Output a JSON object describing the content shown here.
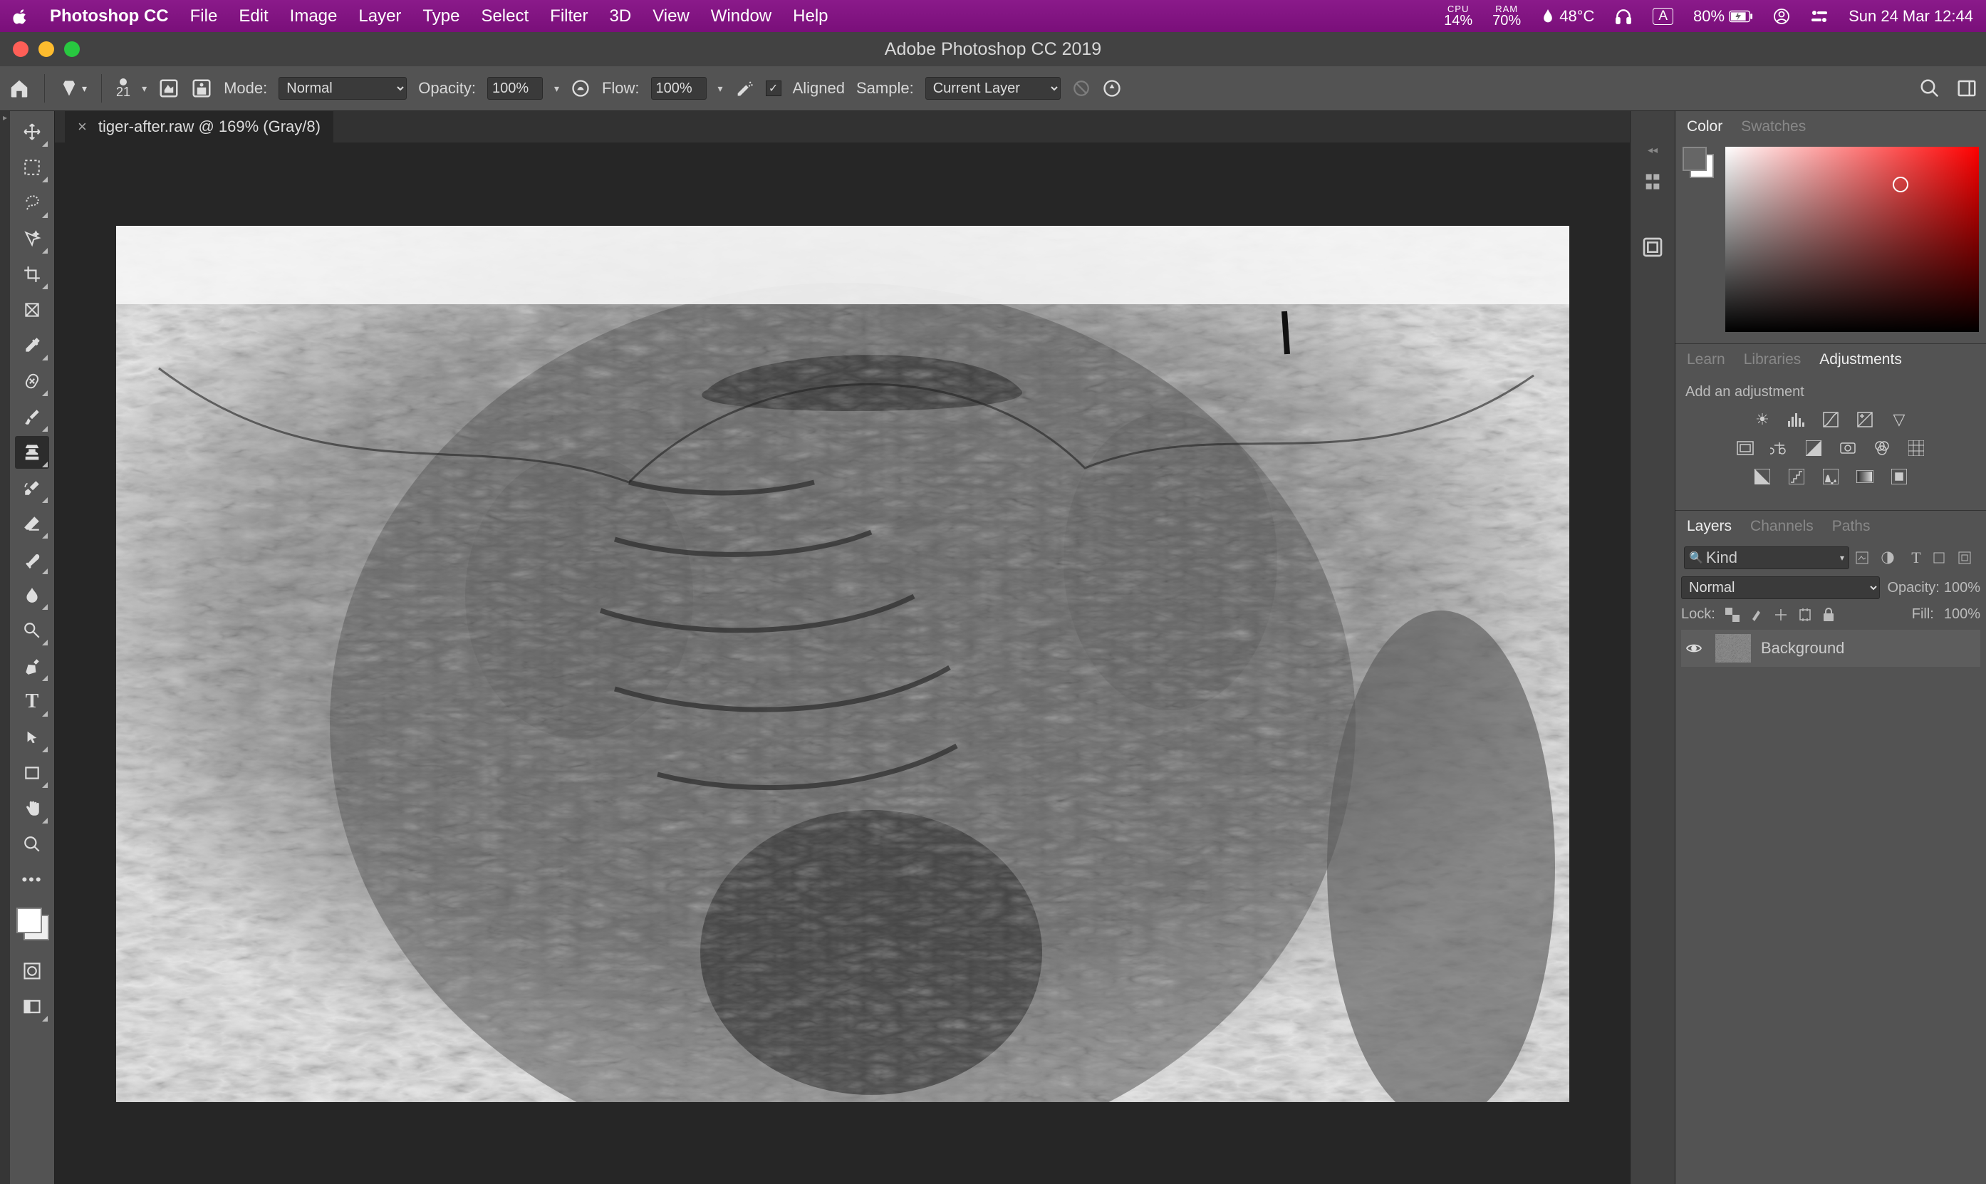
{
  "menubar": {
    "app": "Photoshop CC",
    "items": [
      "File",
      "Edit",
      "Image",
      "Layer",
      "Type",
      "Select",
      "Filter",
      "3D",
      "View",
      "Window",
      "Help"
    ],
    "cpu_label": "CPU",
    "cpu_value": "14%",
    "ram_label": "RAM",
    "ram_value": "70%",
    "temp": "48°C",
    "battery": "80%",
    "datetime": "Sun 24 Mar  12:44",
    "lang": "A"
  },
  "window": {
    "title": "Adobe Photoshop CC 2019"
  },
  "options": {
    "brush_size": "21",
    "mode_label": "Mode:",
    "mode_value": "Normal",
    "opacity_label": "Opacity:",
    "opacity_value": "100%",
    "flow_label": "Flow:",
    "flow_value": "100%",
    "aligned_label": "Aligned",
    "sample_label": "Sample:",
    "sample_value": "Current Layer"
  },
  "document": {
    "tab": "tiger-after.raw @ 169% (Gray/8)"
  },
  "panels": {
    "color_tab": "Color",
    "swatches_tab": "Swatches",
    "learn_tab": "Learn",
    "libraries_tab": "Libraries",
    "adjustments_tab": "Adjustments",
    "add_adj": "Add an adjustment",
    "layers_tab": "Layers",
    "channels_tab": "Channels",
    "paths_tab": "Paths",
    "kind": "Kind",
    "blend": "Normal",
    "opacity_l": "Opacity:",
    "opacity_v": "100%",
    "lock_l": "Lock:",
    "fill_l": "Fill:",
    "fill_v": "100%",
    "layer_name": "Background"
  }
}
